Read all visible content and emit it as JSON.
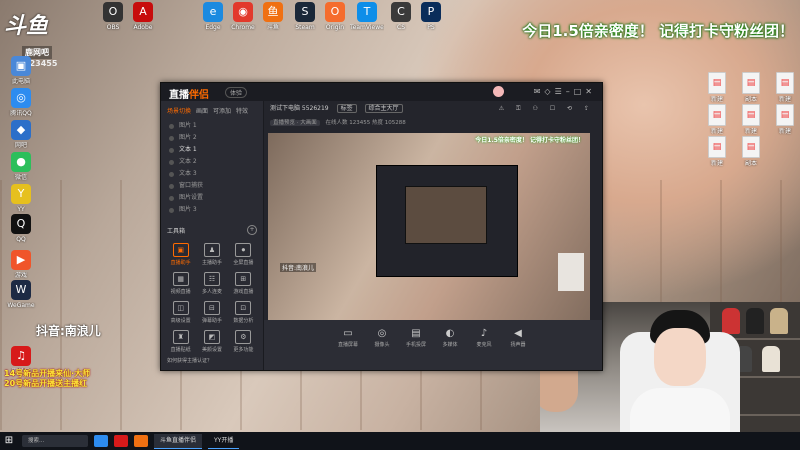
{
  "desktop": {
    "brand_logo": "斗鱼",
    "brand_tag": "鹿网吧",
    "brand_num": "123455",
    "banner": "今日1.5倍亲密度！ 记得打卡守粉丝团！",
    "streamer_name": "抖音:南浪儿",
    "promo_lines": [
      "14号新品开播来仙·大师",
      "20号新品开播送主播红"
    ],
    "icons": [
      {
        "label": "此电脑",
        "glyph": "▣",
        "color": "#4a88d8"
      },
      {
        "label": "腾讯QQ",
        "glyph": "◎",
        "color": "#2d8cf0"
      },
      {
        "label": "网吧",
        "glyph": "◆",
        "color": "#2c6fc9"
      },
      {
        "label": "微信",
        "glyph": "●",
        "color": "#2cbf5b"
      },
      {
        "label": "YY",
        "glyph": "Y",
        "color": "#e6c01e"
      },
      {
        "label": "QQ",
        "glyph": "Q",
        "color": "#111"
      },
      {
        "label": "游戏",
        "glyph": "▶",
        "color": "#f0552a"
      },
      {
        "label": "WeGame",
        "glyph": "W",
        "color": "#1d2a44"
      },
      {
        "label": "网易云",
        "glyph": "♫",
        "color": "#d71a1a"
      },
      {
        "label": "Edge",
        "glyph": "e",
        "color": "#1b8ae0"
      },
      {
        "label": "Chrome",
        "glyph": "◉",
        "color": "#e2392b"
      },
      {
        "label": "斗鱼",
        "glyph": "鱼",
        "color": "#f07012"
      },
      {
        "label": "Steam",
        "glyph": "S",
        "color": "#1b2838"
      },
      {
        "label": "Origin",
        "glyph": "O",
        "color": "#f56c2d"
      },
      {
        "label": "TeamViewer",
        "glyph": "T",
        "color": "#0e8ee9"
      },
      {
        "label": "CS",
        "glyph": "C",
        "color": "#3a3a3a"
      },
      {
        "label": "PS",
        "glyph": "P",
        "color": "#0a2d5a"
      },
      {
        "label": "OBS",
        "glyph": "O",
        "color": "#333"
      },
      {
        "label": "Adobe",
        "glyph": "A",
        "color": "#c70c0c"
      }
    ],
    "file_labels": [
      "新建",
      "副本",
      "新建",
      "新建",
      "新建",
      "新建",
      "新建",
      "副本"
    ]
  },
  "app": {
    "brand_a": "直播",
    "brand_b": "伴侣",
    "version": "体验",
    "scene_tabs": [
      "场景切换",
      "画面",
      "可添加",
      "特效"
    ],
    "scene_rows": [
      "图片 1",
      "图片 2",
      "文本 1",
      "文本 2",
      "文本 3",
      "窗口捕获",
      "图片设置",
      "图片 3"
    ],
    "active_scene": 2,
    "tools_title": "工具箱",
    "tools": [
      {
        "glyph": "▣",
        "label": "直播助手",
        "hot": true
      },
      {
        "glyph": "♟",
        "label": "主播助手"
      },
      {
        "glyph": "⏺",
        "label": "全屏直播"
      },
      {
        "glyph": "▦",
        "label": "视频直播"
      },
      {
        "glyph": "☷",
        "label": "多人连麦"
      },
      {
        "glyph": "⊞",
        "label": "游戏直播"
      },
      {
        "glyph": "◫",
        "label": "高级设置"
      },
      {
        "glyph": "⊟",
        "label": "弹幕助手"
      },
      {
        "glyph": "⊡",
        "label": "数据分析"
      },
      {
        "glyph": "♜",
        "label": "直播贴纸"
      },
      {
        "glyph": "◩",
        "label": "美颜设置"
      },
      {
        "glyph": "⚙",
        "label": "更多功能"
      }
    ],
    "notice": "如何获得主播认证？",
    "info_title": "测试下电脑 5526219",
    "info_tag1": "标签",
    "info_tag2": "综合主大厅",
    "info2_tag": "直播预览 · 大画面",
    "info2_text": "在线人数 123455 热度 105288",
    "preview_banner": "今日1.5倍亲密度！ 记得打卡守粉丝团！",
    "preview_name": "抖音:南浪儿",
    "bottom_buttons": [
      {
        "glyph": "▭",
        "label": "直播屏幕"
      },
      {
        "glyph": "◎",
        "label": "摄像头"
      },
      {
        "glyph": "▤",
        "label": "手机投屏"
      },
      {
        "glyph": "◐",
        "label": "多媒体"
      },
      {
        "glyph": "♪",
        "label": "麦克风"
      },
      {
        "glyph": "◀",
        "label": "扬声器"
      }
    ]
  },
  "taskbar": {
    "search": "搜索...",
    "tasks": [
      "斗鱼直播伴侣",
      "YY开播"
    ]
  }
}
